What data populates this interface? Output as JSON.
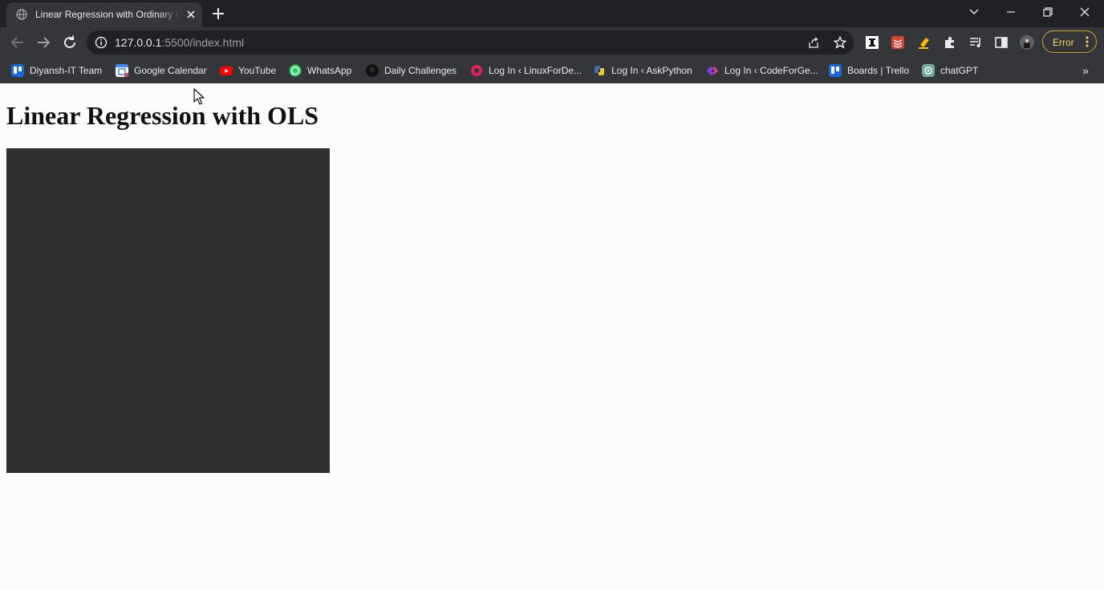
{
  "browser": {
    "tab": {
      "title": "Linear Regression with Ordinary Least Squares",
      "favicon": "globe-icon"
    },
    "new_tab_icon": "plus-icon",
    "window_controls": [
      "chevron-down-icon",
      "minimize-icon",
      "restore-icon",
      "close-icon"
    ],
    "address": {
      "host": "127.0.0.1",
      "rest": ":5500/index.html"
    },
    "error_button": {
      "label": "Error",
      "color": "#fdd663"
    },
    "bookmarks": [
      {
        "label": "Diyansh-IT Team",
        "icon": "trello-icon",
        "color": "#1868db"
      },
      {
        "label": "Google Calendar",
        "icon": "calendar-icon",
        "color": "#4285f4"
      },
      {
        "label": "YouTube",
        "icon": "youtube-icon",
        "color": "#ff0000"
      },
      {
        "label": "WhatsApp",
        "icon": "whatsapp-icon",
        "color": "#25d366"
      },
      {
        "label": "Daily Challenges",
        "icon": "github-icon",
        "color": "#111111"
      },
      {
        "label": "Log In ‹ LinuxForDe...",
        "icon": "linuxfordevices-icon",
        "color": "#e0245e"
      },
      {
        "label": "Log In ‹ AskPython",
        "icon": "python-icon",
        "color": "#3b6fb6"
      },
      {
        "label": "Log In ‹ CodeForGe...",
        "icon": "codeforgeek-icon",
        "color": "#8a3ffc"
      },
      {
        "label": "Boards | Trello",
        "icon": "trello-icon",
        "color": "#1868db"
      },
      {
        "label": "chatGPT",
        "icon": "chatgpt-icon",
        "color": "#74aa9c"
      }
    ],
    "bookmarks_overflow": "»"
  },
  "page": {
    "heading": "Linear Regression with OLS",
    "canvas_color": "#303030"
  }
}
